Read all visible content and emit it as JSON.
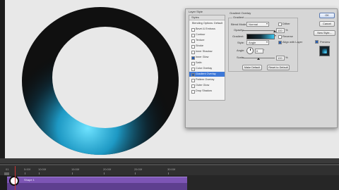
{
  "dialog": {
    "title": "Layer Style",
    "styles_header": "Styles",
    "styles": [
      {
        "label": "Blending Options: Default",
        "checkbox": false
      },
      {
        "label": "Bevel & Emboss",
        "checkbox": true,
        "checked": false
      },
      {
        "label": "Contour",
        "checkbox": true,
        "checked": false
      },
      {
        "label": "Texture",
        "checkbox": true,
        "checked": false
      },
      {
        "label": "Stroke",
        "checkbox": true,
        "checked": false
      },
      {
        "label": "Inner Shadow",
        "checkbox": true,
        "checked": false
      },
      {
        "label": "Inner Glow",
        "checkbox": true,
        "checked": true
      },
      {
        "label": "Satin",
        "checkbox": true,
        "checked": false
      },
      {
        "label": "Color Overlay",
        "checkbox": true,
        "checked": false
      },
      {
        "label": "Gradient Overlay",
        "checkbox": true,
        "checked": true,
        "selected": true
      },
      {
        "label": "Pattern Overlay",
        "checkbox": true,
        "checked": false
      },
      {
        "label": "Outer Glow",
        "checkbox": true,
        "checked": false
      },
      {
        "label": "Drop Shadow",
        "checkbox": true,
        "checked": false
      }
    ],
    "section_title": "Gradient Overlay",
    "group_title": "Gradient",
    "blend_mode_label": "Blend Mode:",
    "blend_mode_value": "Normal",
    "dither_label": "Dither",
    "opacity_label": "Opacity:",
    "opacity_value": "100",
    "opacity_unit": "%",
    "opacity_level": 1.0,
    "gradient_label": "Gradient:",
    "reverse_label": "Reverse",
    "style_label": "Style:",
    "style_value": "Angle",
    "align_label": "Align with Layer",
    "angle_label": "Angle:",
    "angle_value": "0",
    "angle_unit": "°",
    "scale_label": "Scale:",
    "scale_value": "100",
    "scale_unit": "%",
    "scale_level": 0.5,
    "make_default_label": "Make Default",
    "reset_default_label": "Reset to Default",
    "ok_label": "OK",
    "cancel_label": "Cancel",
    "new_style_label": "New Style...",
    "preview_label": "Preview",
    "preview_checked": true
  },
  "timeline": {
    "ticks": [
      "01",
      "5:00f",
      "10:00f",
      "15:00f",
      "20:00f",
      "25:00f",
      "30:00f"
    ],
    "layer_name": "Shape 1"
  },
  "colors": {
    "ring_glow": "#3cc8f0",
    "layer_bar": "#7d55b5",
    "selected_row": "#3d78d8"
  }
}
